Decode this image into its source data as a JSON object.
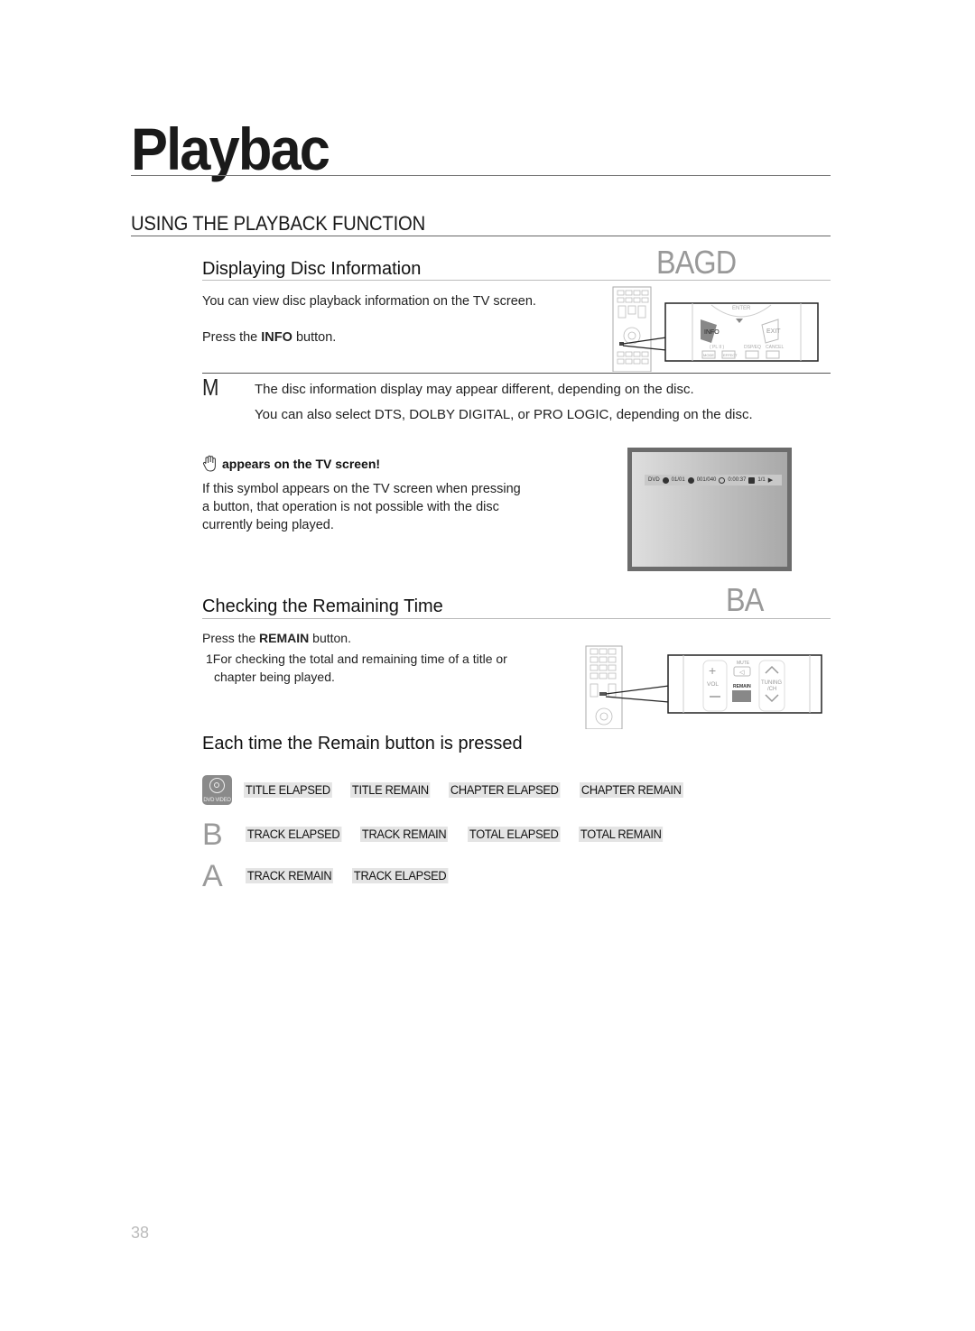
{
  "chapter": {
    "title": "Playbac"
  },
  "section": {
    "title": "USING THE PLAYBACK FUNCTION"
  },
  "display_info": {
    "title": "Displaying Disc Information",
    "disc_tags": "BAGD",
    "intro": "You can view disc playback information  on the TV screen.",
    "step_prefix": "Press the ",
    "step_button": "INFO",
    "step_suffix": " button.",
    "remote_labels": {
      "enter": "ENTER",
      "info": "INFO",
      "exit": "EXIT",
      "mode": "MODE",
      "effect": "EFFECT",
      "dsp": "DSP/EQ",
      "cancel": "CANCEL",
      "pl2": "( PL II )"
    }
  },
  "note": {
    "mark": "M",
    "lines": [
      "The disc information display may appear different, depending on the disc.",
      "You can also select DTS, DOLBY DIGITAL, or PRO LOGIC, depending on the disc."
    ]
  },
  "prohibit": {
    "icon": "hand-icon",
    "heading": "appears on the TV screen!",
    "text_lines": [
      "If this symbol appears on the TV screen when pressing",
      "a button, that operation is not possible with the disc",
      "currently being played."
    ]
  },
  "tv_osd": {
    "disc": "DVD",
    "title": "01/01",
    "chapter": "001/040",
    "time": "0:00:37",
    "angle": "1/1",
    "play_icon": "play-icon"
  },
  "remaining": {
    "title": "Checking the Remaining Time",
    "disc_tags": "BA",
    "step_prefix": "Press the ",
    "step_button": "REMAIN",
    "step_suffix": " button.",
    "detail_line1": "1For checking the total and remaining time of a title or",
    "detail_line2": "chapter being played.",
    "remote_labels": {
      "vol": "VOL",
      "mute": "MUTE",
      "remain": "REMAIN",
      "tuning": "TUNING",
      "ch": "/CH"
    }
  },
  "sequence": {
    "title": "Each time the Remain button is pressed",
    "rows": [
      {
        "mark": "dvd-video-icon",
        "badge_label": "DVD VIDEO",
        "steps": [
          "TITLE ELAPSED",
          "TITLE REMAIN",
          "CHAPTER ELAPSED",
          "CHAPTER REMAIN"
        ]
      },
      {
        "mark": "B",
        "steps": [
          "TRACK ELAPSED",
          "TRACK REMAIN",
          "TOTAL ELAPSED",
          "TOTAL REMAIN"
        ]
      },
      {
        "mark": "A",
        "steps": [
          "TRACK REMAIN",
          "TRACK ELAPSED"
        ]
      }
    ]
  },
  "page": {
    "number": "38"
  }
}
